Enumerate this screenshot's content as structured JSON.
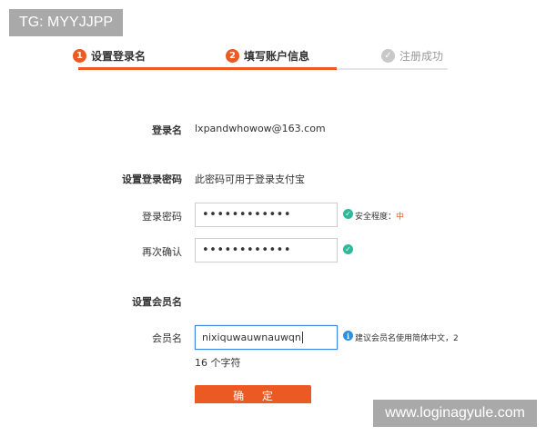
{
  "watermarks": {
    "top_left": "TG: MYYJJPP",
    "bottom_right": "www.loginagyule.com"
  },
  "steps": [
    {
      "number": "1",
      "label": "设置登录名"
    },
    {
      "number": "2",
      "label": "填写账户信息"
    },
    {
      "icon": "check-circle-icon",
      "label": "注册成功"
    }
  ],
  "progress": {
    "current_step": 2,
    "total_steps": 3
  },
  "login": {
    "label": "登录名",
    "value": "lxpandwhowow@163.com"
  },
  "password_section": {
    "title": "设置登录密码",
    "note": "此密码可用于登录支付宝"
  },
  "password": {
    "label": "登录密码",
    "value": "••••••••••••",
    "strength_prefix": "安全程度：",
    "strength_level": "中"
  },
  "confirm": {
    "label": "再次确认",
    "value": "••••••••••••"
  },
  "member_section": {
    "title": "设置会员名"
  },
  "member": {
    "label": "会员名",
    "value": "nixiquwauwnauwqn",
    "hint": "建议会员名使用简体中文，2",
    "count": "16 个字符"
  },
  "submit": {
    "label": "确 定"
  },
  "colors": {
    "accent": "#ea5a22",
    "success": "#2fb89a",
    "info": "#2f8fe0",
    "focus": "#3d86e0"
  }
}
